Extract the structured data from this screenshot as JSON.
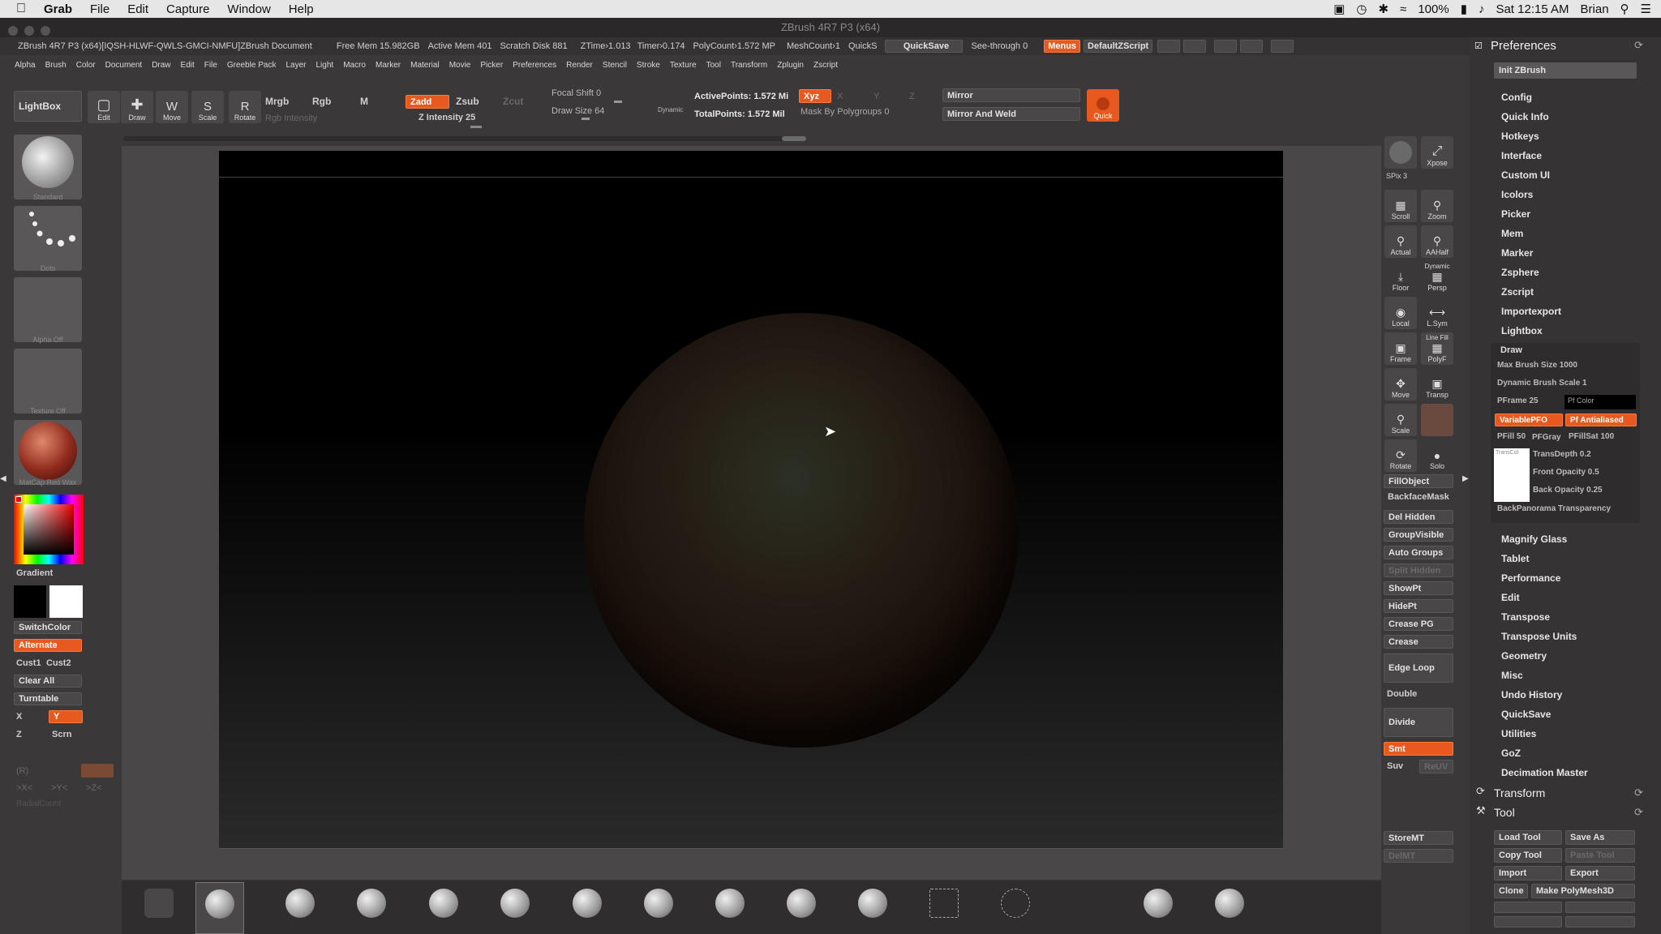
{
  "macmenu": {
    "apple": "",
    "app": "Grab",
    "items": [
      "File",
      "Edit",
      "Capture",
      "Window",
      "Help"
    ]
  },
  "macstatus": {
    "battery": "100%",
    "datetime": "Sat 12:15 AM",
    "user": "Brian"
  },
  "window": {
    "title": "ZBrush 4R7 P3 (x64)"
  },
  "infobar": {
    "doc": "ZBrush 4R7 P3 (x64)[IQSH-HLWF-QWLS-GMCI-NMFU]ZBrush Document",
    "free_mem": "Free Mem 15.982GB",
    "active_mem": "Active Mem 401",
    "scratch": "Scratch Disk 881",
    "ztime": "ZTime›1.013",
    "timer": "Timer›0.174",
    "polycount": "PolyCount›1.572 MP",
    "meshcount": "MeshCount›1",
    "quicks": "QuickS",
    "quicksave": "QuickSave",
    "seethrough": "See-through  0",
    "menus": "Menus",
    "defaultzscript": "DefaultZScript"
  },
  "menubar": [
    "Alpha",
    "Brush",
    "Color",
    "Document",
    "Draw",
    "Edit",
    "File",
    "Greeble Pack",
    "Layer",
    "Light",
    "Macro",
    "Marker",
    "Material",
    "Movie",
    "Picker",
    "Preferences",
    "Render",
    "Stencil",
    "Stroke",
    "Texture",
    "Tool",
    "Transform",
    "Zplugin",
    "Zscript"
  ],
  "toolbar": {
    "lightbox": "LightBox",
    "edit": "Edit",
    "draw": "Draw",
    "move": "Move",
    "scale": "Scale",
    "rotate": "Rotate",
    "mrgb": "Mrgb",
    "rgb": "Rgb",
    "m": "M",
    "zadd": "Zadd",
    "zsub": "Zsub",
    "zcut": "Zcut",
    "rgb_intensity": "Rgb Intensity",
    "z_intensity": "Z Intensity 25",
    "focal_shift": "Focal Shift 0",
    "draw_size": "Draw Size 64",
    "dynamic": "Dynamic",
    "active_points": "ActivePoints: 1.572  Mi",
    "total_points": "TotalPoints: 1.572  Mil",
    "xyz": "Xyz",
    "x": "X",
    "y": "Y",
    "z": "Z",
    "mask_by_polygroups": "Mask By Polygroups 0",
    "mirror": "Mirror",
    "mirror_weld": "Mirror And Weld",
    "quick": "Quick"
  },
  "left": {
    "standard": "Standard",
    "dots": "Dots",
    "alpha_off": "Alpha  Off",
    "texture_off": "Texture  Off",
    "matcap": "MatCap Red Wax",
    "gradient": "Gradient",
    "switchcolor": "SwitchColor",
    "alternate": "Alternate",
    "cust1": "Cust1",
    "cust2": "Cust2",
    "clear_all": "Clear All",
    "turntable": "Turntable",
    "x": "X",
    "y": "Y",
    "z": "Z",
    "scrn": "Scrn",
    "r": "(R)",
    "xc": ">X<",
    "yc": ">Y<",
    "zc": ">Z<",
    "radial": "RadialCount"
  },
  "rightshelf": {
    "bpr": "BPR",
    "spix": "SPix 3",
    "xpose": "Xpose",
    "scroll": "Scroll",
    "zoom": "Zoom",
    "actual": "Actual",
    "aahalf": "AAHalf",
    "floor": "Floor",
    "persp": "Persp",
    "dynamic": "Dynamic",
    "local": "Local",
    "lsym": "L.Sym",
    "frame": "Frame",
    "polyf": "PolyF",
    "line_fill": "Line Fill",
    "move": "Move",
    "transp": "Transp",
    "scale": "Scale",
    "rotate": "Rotate",
    "solo": "Solo",
    "buttons": [
      "FillObject",
      "BackfaceMask",
      "Del Hidden",
      "GroupVisible",
      "Auto Groups",
      "Split Hidden",
      "ShowPt",
      "HidePt",
      "Crease PG",
      "Crease",
      "Edge Loop",
      "Double",
      "Divide",
      "Smt",
      "Suv",
      "ReUV",
      "StoreMT",
      "DelMT"
    ]
  },
  "prefs": {
    "title": "Preferences",
    "init": "Init ZBrush",
    "items_top": [
      "Config",
      "Quick Info",
      "Hotkeys",
      "Interface",
      "Custom UI",
      "Icolors",
      "Picker",
      "Mem",
      "Marker",
      "Zsphere",
      "Zscript",
      "Importexport",
      "Lightbox"
    ],
    "draw_title": "Draw",
    "max_brush": "Max Brush Size 1000",
    "dyn_brush": "Dynamic Brush Scale 1",
    "pframe": "PFrame 25",
    "pf_color": "Pf Color",
    "variablepfo": "VariablePFO",
    "pf_antialias": "Pf Antialiased",
    "pfill": "PFill 50",
    "pfgray": "PFGray",
    "pfillsat": "PFillSat 100",
    "transcol": "TransCol",
    "transdepth": "TransDepth 0.2",
    "front_opacity": "Front Opacity 0.5",
    "back_opacity": "Back Opacity 0.25",
    "backpanorama": "BackPanorama Transparency",
    "items_bottom": [
      "Magnify Glass",
      "Tablet",
      "Performance",
      "Edit",
      "Transpose",
      "Transpose Units",
      "Geometry",
      "Misc",
      "Undo History",
      "QuickSave",
      "Utilities",
      "GoZ",
      "Decimation Master"
    ],
    "transform": "Transform",
    "tool": "Tool",
    "load_tool": "Load Tool",
    "save_as": "Save As",
    "copy_tool": "Copy Tool",
    "paste_tool": "Paste Tool",
    "import": "Import",
    "export": "Export",
    "clone": "Clone",
    "make_polymesh": "Make PolyMesh3D"
  }
}
